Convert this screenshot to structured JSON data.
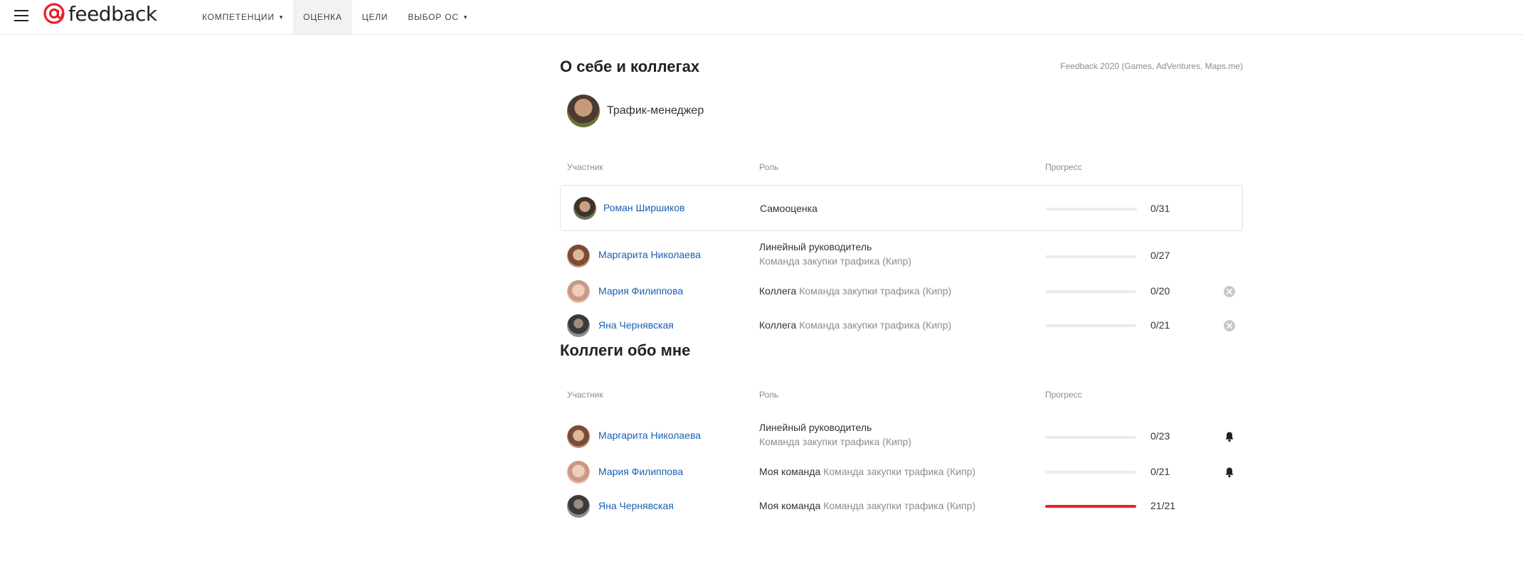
{
  "header": {
    "logo_text": "feedback",
    "nav": [
      {
        "label": "КОМПЕТЕНЦИИ",
        "has_dropdown": true,
        "active": false
      },
      {
        "label": "ОЦЕНКА",
        "has_dropdown": false,
        "active": true
      },
      {
        "label": "ЦЕЛИ",
        "has_dropdown": false,
        "active": false
      },
      {
        "label": "ВЫБОР ОС",
        "has_dropdown": true,
        "active": false
      }
    ],
    "caret": "▾"
  },
  "about": {
    "title": "О себе и коллегах",
    "project": "Feedback 2020 (Games, AdVentures, Maps.me)",
    "profile_role": "Трафик-менеджер",
    "columns": {
      "participant": "Участник",
      "role": "Роль",
      "progress": "Прогресс"
    },
    "rows": [
      {
        "name": "Роман Ширшиков",
        "role": "Самооценка",
        "role_sub": "",
        "count": "0/31",
        "progress": 0,
        "action": "none"
      },
      {
        "name": "Маргарита Николаева",
        "role": "Линейный руководитель",
        "role_sub": "Команда закупки трафика (Кипр)",
        "count": "0/27",
        "progress": 0,
        "action": "none"
      },
      {
        "name": "Мария Филиппова",
        "role": "Коллега",
        "role_sub": "Команда закупки трафика (Кипр)",
        "count": "0/20",
        "progress": 0,
        "action": "remove-icon"
      },
      {
        "name": "Яна Чернявская",
        "role": "Коллега",
        "role_sub": "Команда закупки трафика (Кипр)",
        "count": "0/21",
        "progress": 0,
        "action": "remove-icon"
      }
    ]
  },
  "colleagues": {
    "title": "Коллеги обо мне",
    "columns": {
      "participant": "Участник",
      "role": "Роль",
      "progress": "Прогресс"
    },
    "rows": [
      {
        "name": "Маргарита Николаева",
        "role": "Линейный руководитель",
        "role_sub": "Команда закупки трафика (Кипр)",
        "count": "0/23",
        "progress": 0,
        "action": "bell-icon"
      },
      {
        "name": "Мария Филиппова",
        "role": "Моя команда",
        "role_sub": "Команда закупки трафика (Кипр)",
        "count": "0/21",
        "progress": 0,
        "action": "bell-icon"
      },
      {
        "name": "Яна Чернявская",
        "role": "Моя команда",
        "role_sub": "Команда закупки трафика (Кипр)",
        "count": "21/21",
        "progress": 1,
        "action": "none"
      }
    ]
  },
  "colors": {
    "accent": "#e8202a",
    "link": "#1a5fb4",
    "muted": "#8c8c8c"
  }
}
